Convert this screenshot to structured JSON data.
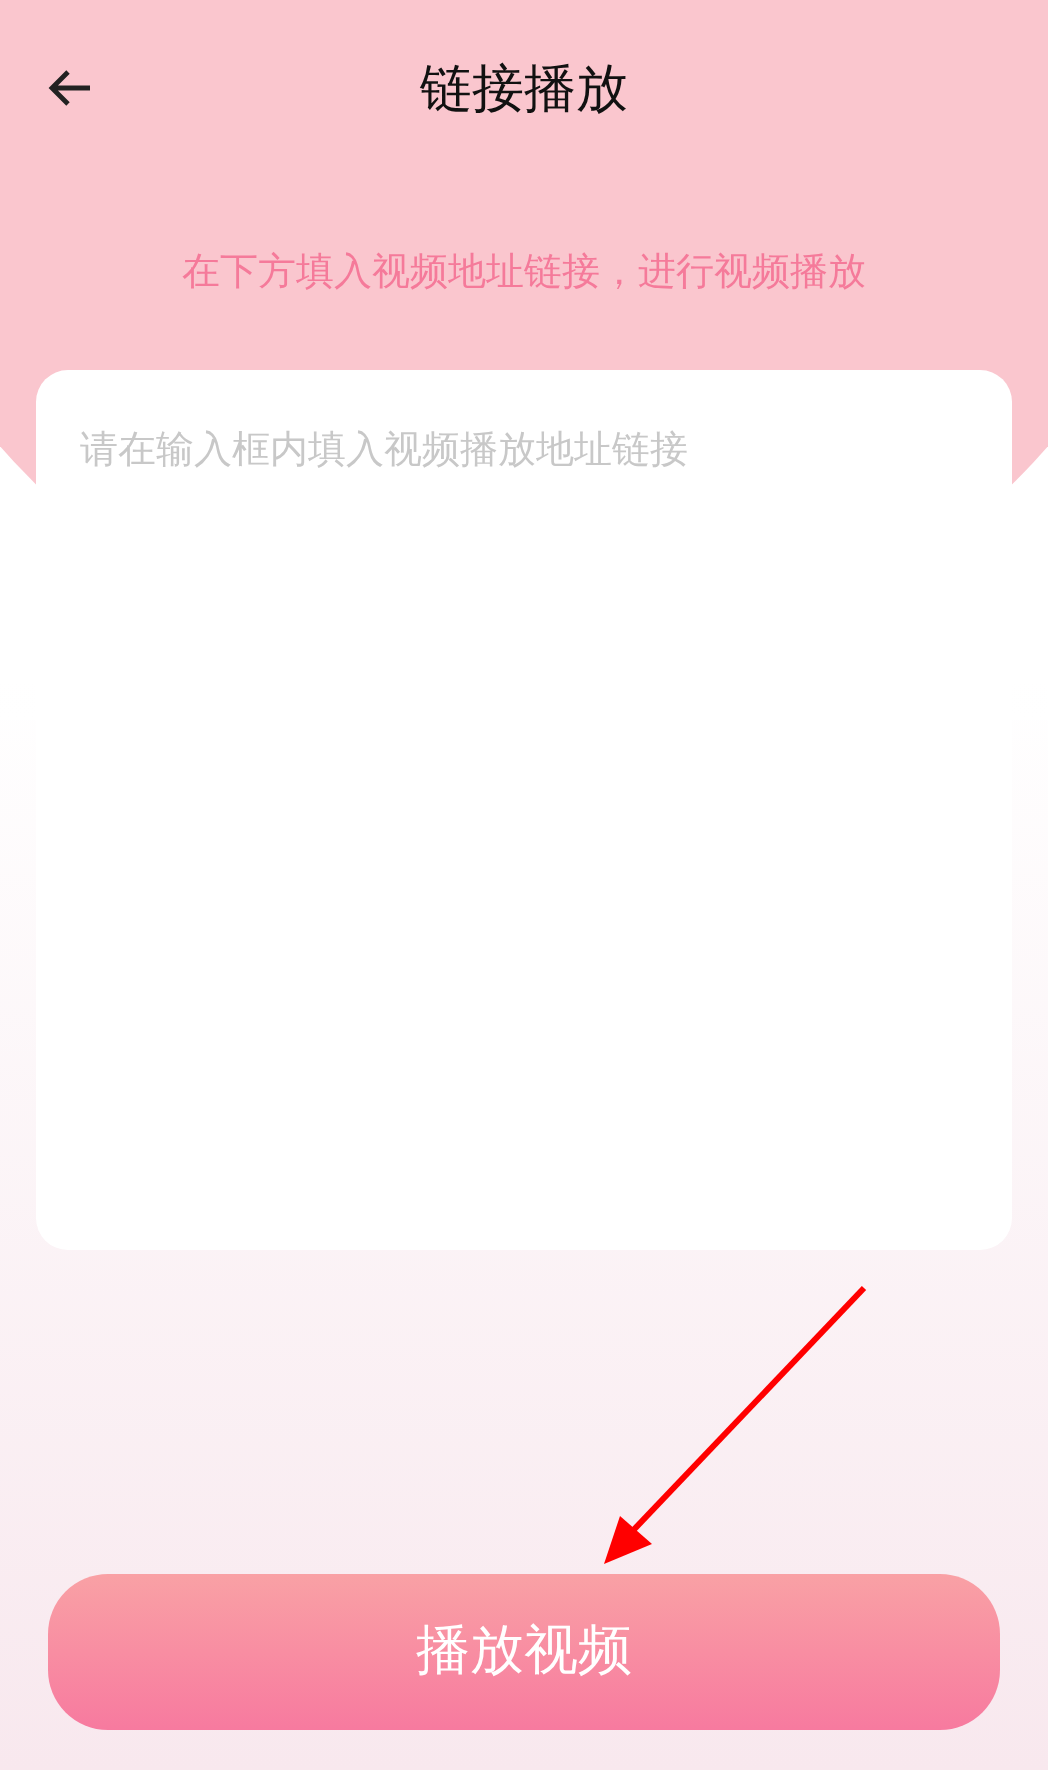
{
  "header": {
    "title": "链接播放"
  },
  "instruction": "在下方填入视频地址链接，进行视频播放",
  "url_field": {
    "placeholder": "请在输入框内填入视频播放地址链接"
  },
  "buttons": [
    {
      "label": "播放视频"
    }
  ]
}
